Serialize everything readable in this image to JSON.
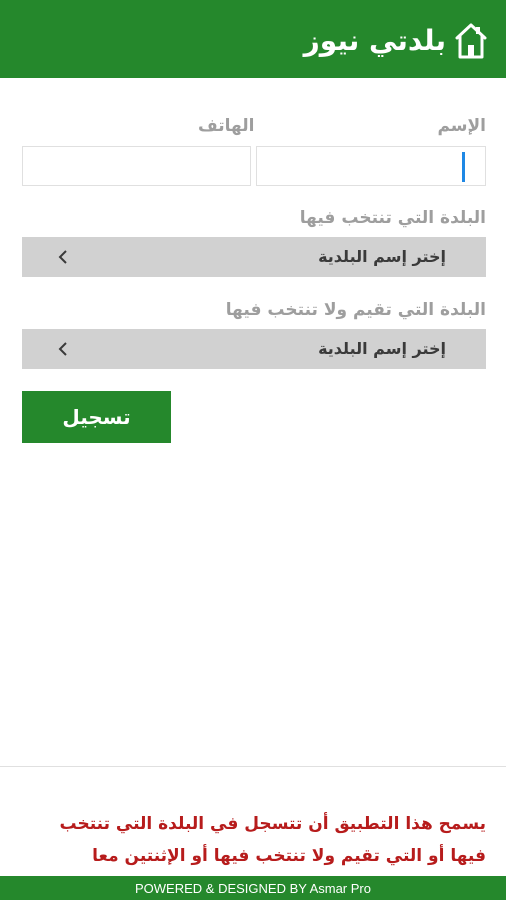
{
  "header": {
    "app_title": "بلدتي نيوز",
    "logo_icon": "house-logo-icon",
    "background_color": "#25882c"
  },
  "form": {
    "name_label": "الإسم",
    "phone_label": "الهاتف",
    "name_value": "",
    "phone_value": "",
    "vote_town_label": "البلدة التي تنتخب فيها",
    "vote_town_value": "إختر إسم البلدية",
    "residence_town_label": "البلدة التي تقيم ولا تنتخب فيها",
    "residence_town_value": "إختر إسم البلدية",
    "register_label": "تسجيل"
  },
  "notice": {
    "line1": "يسمح هذا التطبيق أن تتسجل في البلدة التي تنتخب",
    "line2": "فيها أو التي تقيم ولا تنتخب فيها أو الإثنتين معا",
    "color": "#b71c1c"
  },
  "footer": {
    "text": "POWERED & DESIGNED BY Asmar Pro"
  }
}
